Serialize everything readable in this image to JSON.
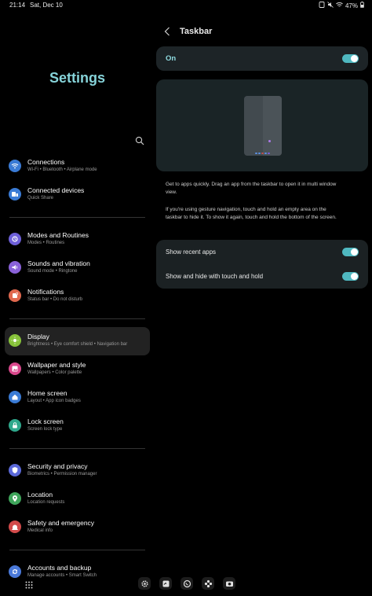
{
  "status": {
    "time": "21:14",
    "date": "Sat, Dec 10",
    "battery": "47%"
  },
  "left": {
    "title": "Settings",
    "groups": [
      [
        {
          "label": "Connections",
          "sub": "Wi-Fi  •  Bluetooth  •  Airplane mode",
          "icon": "wifi-icon",
          "color": "#3a7bd5"
        },
        {
          "label": "Connected devices",
          "sub": "Quick Share",
          "icon": "connected-devices-icon",
          "color": "#3a7bd5"
        }
      ],
      [
        {
          "label": "Modes and Routines",
          "sub": "Modes  •  Routines",
          "icon": "routines-icon",
          "color": "#6e60d9"
        },
        {
          "label": "Sounds and vibration",
          "sub": "Sound mode  •  Ringtone",
          "icon": "sound-icon",
          "color": "#8a62d9"
        },
        {
          "label": "Notifications",
          "sub": "Status bar  •  Do not disturb",
          "icon": "notifications-icon",
          "color": "#e0684e"
        }
      ],
      [
        {
          "label": "Display",
          "sub": "Brightness  •  Eye comfort shield  •  Navigation bar",
          "icon": "display-icon",
          "color": "#87c23a",
          "active": true
        },
        {
          "label": "Wallpaper and style",
          "sub": "Wallpapers  •  Color palette",
          "icon": "wallpaper-icon",
          "color": "#d9488c"
        },
        {
          "label": "Home screen",
          "sub": "Layout  •  App icon badges",
          "icon": "home-icon",
          "color": "#3a7bd5"
        },
        {
          "label": "Lock screen",
          "sub": "Screen lock type",
          "icon": "lock-icon",
          "color": "#2ea88c"
        }
      ],
      [
        {
          "label": "Security and privacy",
          "sub": "Biometrics  •  Permission manager",
          "icon": "shield-icon",
          "color": "#5b69d9"
        },
        {
          "label": "Location",
          "sub": "Location requests",
          "icon": "location-icon",
          "color": "#3fa55b"
        },
        {
          "label": "Safety and emergency",
          "sub": "Medical info",
          "icon": "emergency-icon",
          "color": "#d24a4a"
        }
      ],
      [
        {
          "label": "Accounts and backup",
          "sub": "Manage accounts  •  Smart Switch",
          "icon": "accounts-icon",
          "color": "#4a79d9"
        }
      ]
    ]
  },
  "right": {
    "title": "Taskbar",
    "master_toggle_label": "On",
    "master_toggle_on": true,
    "desc1": "Get to apps quickly. Drag an app from the taskbar to open it in multi window view.",
    "desc2": "If you're using gesture navigation, touch and hold an empty area on the taskbar to hide it. To show it again, touch and hold the bottom of the screen.",
    "options": [
      {
        "label": "Show recent apps",
        "on": true
      },
      {
        "label": "Show and hide with touch and hold",
        "on": true
      }
    ]
  },
  "dock": {
    "apps": [
      "settings-icon",
      "notes-icon",
      "whatsapp-icon",
      "gallery-icon",
      "camera-icon"
    ]
  }
}
